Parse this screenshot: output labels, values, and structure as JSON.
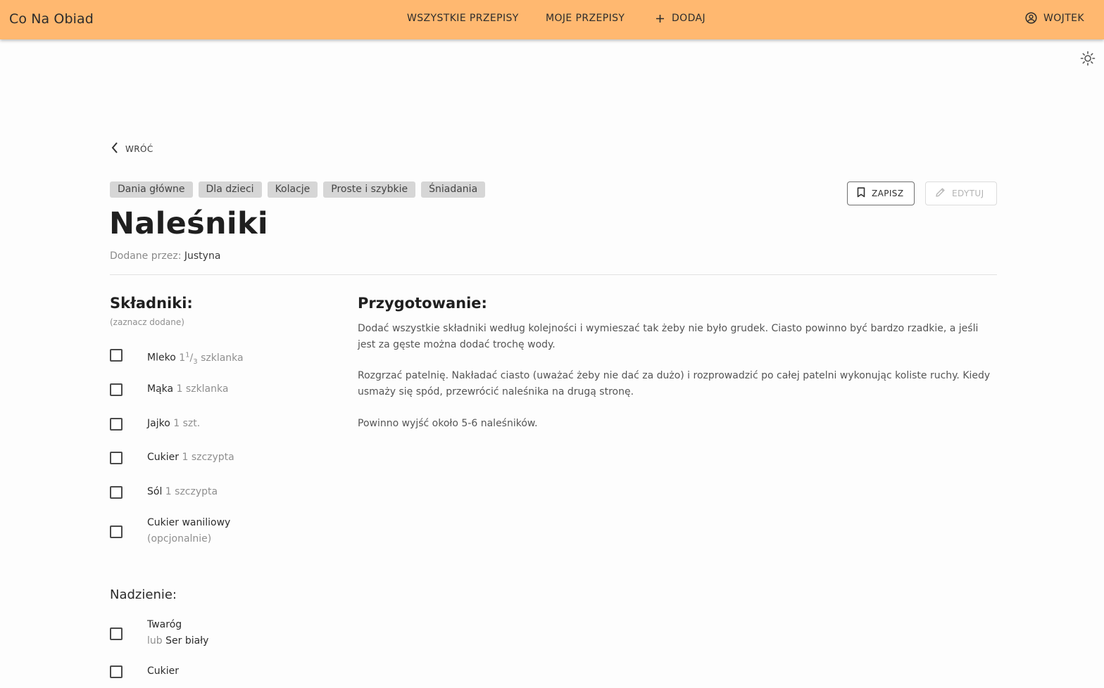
{
  "header": {
    "brand": "Co Na Obiad",
    "nav": {
      "all": "WSZYSTKIE PRZEPISY",
      "mine": "MOJE PRZEPISY",
      "add": "DODAJ"
    },
    "user": "WOJTEK",
    "accent_color": "#ffb870"
  },
  "back_label": "WRÓĆ",
  "tags": [
    "Dania główne",
    "Dla dzieci",
    "Kolacje",
    "Proste i szybkie",
    "Śniadania"
  ],
  "actions": {
    "save": "ZAPISZ",
    "edit": "EDYTUJ"
  },
  "recipe": {
    "title": "Naleśniki",
    "author_prefix": "Dodane przez:",
    "author": "Justyna"
  },
  "ingredients": {
    "title": "Składniki:",
    "hint": "(zaznacz dodane)",
    "items": [
      {
        "name": "Mleko",
        "qty_whole": "1",
        "qty_num": "1",
        "qty_den": "3",
        "qty_unit": "szklanka"
      },
      {
        "name": "Mąka",
        "qty": "1 szklanka"
      },
      {
        "name": "Jajko",
        "qty": "1 szt."
      },
      {
        "name": "Cukier",
        "qty": "1 szczypta"
      },
      {
        "name": "Sól",
        "qty": "1 szczypta"
      },
      {
        "name": "Cukier waniliowy",
        "note": "(opcjonalnie)"
      }
    ]
  },
  "filling": {
    "title": "Nadzienie:",
    "items": [
      {
        "name": "Twaróg",
        "alt_prefix": "lub",
        "alt": "Ser biały"
      },
      {
        "name": "Cukier"
      }
    ]
  },
  "preparation": {
    "title": "Przygotowanie:",
    "paragraphs": [
      "Dodać wszystkie składniki według kolejności i wymieszać tak żeby nie było grudek. Ciasto powinno być bardzo rzadkie, a jeśli jest za gęste można dodać trochę wody.",
      "Rozgrzać patelnię. Nakładać ciasto (uważać żeby nie dać za dużo) i rozprowadzić po całej patelni wykonując koliste ruchy. Kiedy usmaży się spód, przewrócić naleśnika na drugą stronę.",
      "Powinno wyjść około 5-6 naleśników."
    ]
  }
}
